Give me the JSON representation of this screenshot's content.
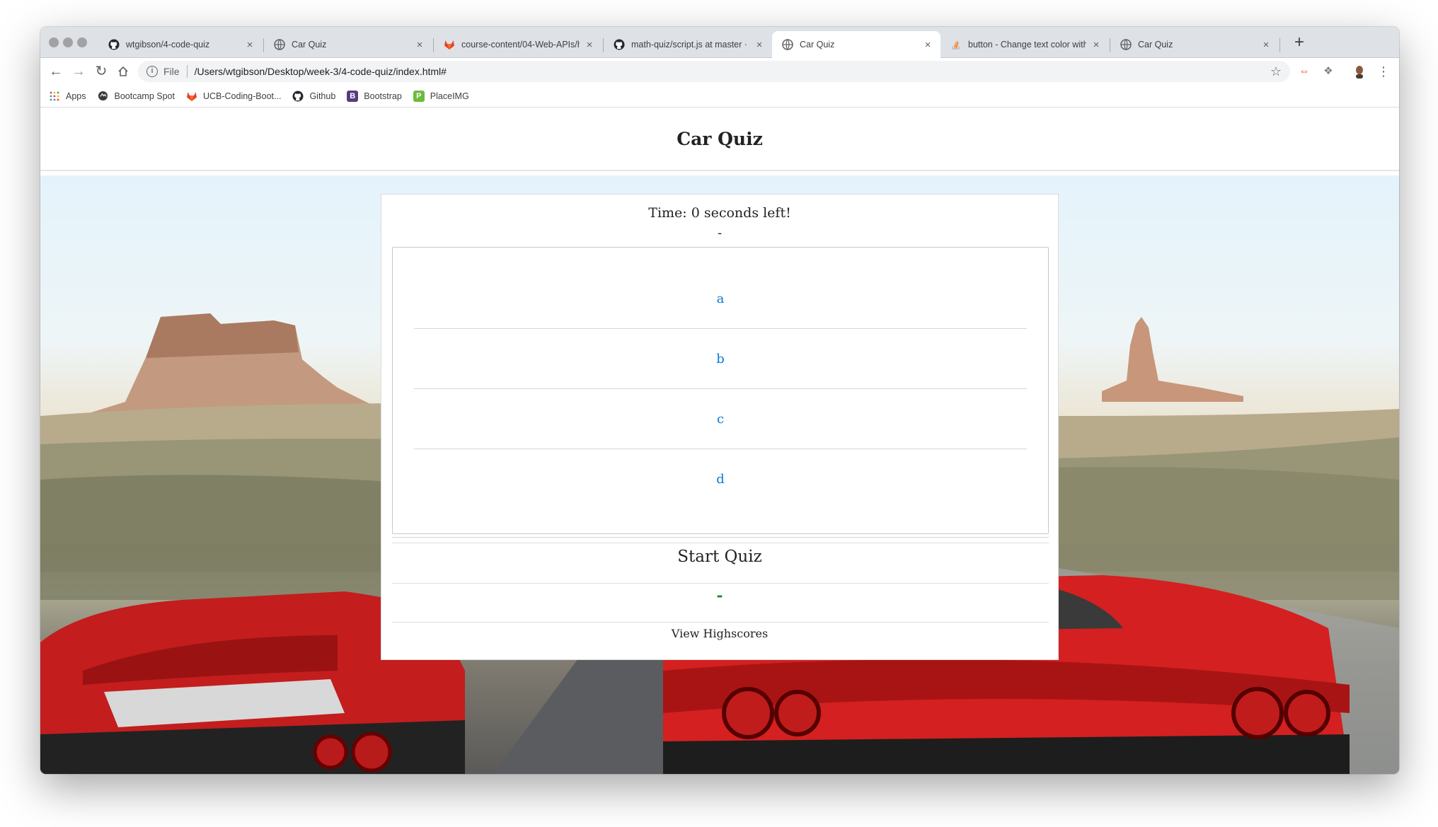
{
  "browser": {
    "tabs": [
      {
        "title": "wtgibson/4-code-quiz",
        "icon": "github-icon",
        "active": false
      },
      {
        "title": "Car Quiz",
        "icon": "globe-icon",
        "active": false
      },
      {
        "title": "course-content/04-Web-APIs/h",
        "icon": "gitlab-icon",
        "active": false
      },
      {
        "title": "math-quiz/script.js at master · ar",
        "icon": "github-icon",
        "active": false
      },
      {
        "title": "Car Quiz",
        "icon": "globe-icon",
        "active": true
      },
      {
        "title": "button - Change text color with",
        "icon": "stackoverflow-icon",
        "active": false
      },
      {
        "title": "Car Quiz",
        "icon": "globe-icon",
        "active": false
      }
    ],
    "new_tab": "+",
    "close_glyph": "×",
    "omnibox": {
      "scheme_label": "File",
      "url": "/Users/wtgibson/Desktop/week-3/4-code-quiz/index.html#"
    },
    "bookmarks": [
      {
        "label": "Apps",
        "icon": "apps-grid-icon"
      },
      {
        "label": "Bootcamp Spot",
        "icon": "bootcamp-icon"
      },
      {
        "label": "UCB-Coding-Boot...",
        "icon": "gitlab-icon"
      },
      {
        "label": "Github",
        "icon": "github-icon"
      },
      {
        "label": "Bootstrap",
        "icon": "bootstrap-icon",
        "glyph": "B",
        "color": "#563d7c"
      },
      {
        "label": "PlaceIMG",
        "icon": "placeimg-icon",
        "glyph": "P",
        "color": "#6cbb3c"
      }
    ]
  },
  "page": {
    "title": "Car Quiz",
    "timer": "Time: 0 seconds left!",
    "question": "-",
    "answers": [
      "a",
      "b",
      "c",
      "d"
    ],
    "start_button": "Start Quiz",
    "feedback": "-",
    "highscores_link": "View Highscores"
  },
  "colors": {
    "answer_link": "#0a78d2",
    "feedback": "#1e8a2e"
  }
}
